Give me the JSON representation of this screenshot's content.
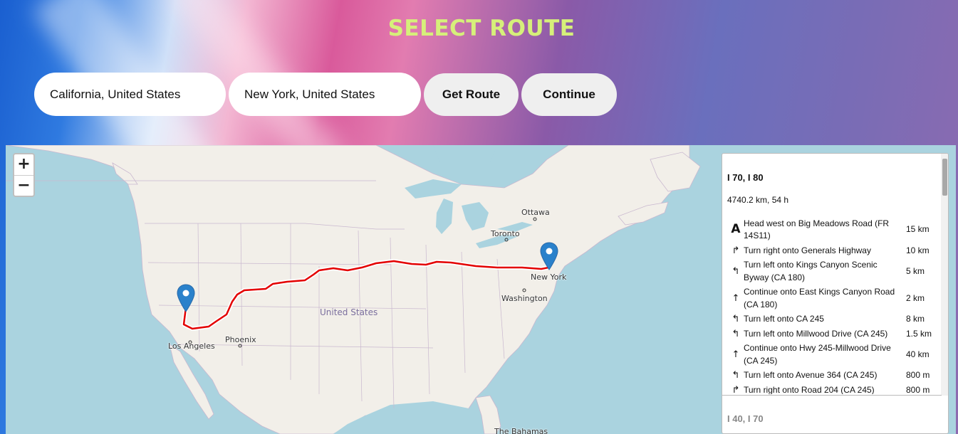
{
  "page": {
    "title": "SELECT ROUTE"
  },
  "form": {
    "from_value": "California, United States",
    "to_value": "New York, United States",
    "get_route_label": "Get Route",
    "continue_label": "Continue"
  },
  "map": {
    "zoom_in": "+",
    "zoom_out": "−",
    "country_label": "United States",
    "cities": [
      "Ottawa",
      "Toronto",
      "New York",
      "Washington",
      "Los Angeles",
      "Phoenix",
      "The Bahamas"
    ],
    "origin_marker": "map-pin-icon",
    "destination_marker": "map-pin-icon",
    "route_color": "#e30000"
  },
  "directions": {
    "route_name": "I 70, I 80",
    "summary": "4740.2 km, 54 h",
    "steps": [
      {
        "icon": "depart-icon",
        "text": "Head west on Big Meadows Road (FR 14S11)",
        "distance": "15 km"
      },
      {
        "icon": "turn-right-icon",
        "text": "Turn right onto Generals Highway",
        "distance": "10 km"
      },
      {
        "icon": "turn-left-icon",
        "text": "Turn left onto Kings Canyon Scenic Byway (CA 180)",
        "distance": "5 km"
      },
      {
        "icon": "straight-icon",
        "text": "Continue onto East Kings Canyon Road (CA 180)",
        "distance": "2 km"
      },
      {
        "icon": "turn-left-icon",
        "text": "Turn left onto CA 245",
        "distance": "8 km"
      },
      {
        "icon": "turn-left-icon",
        "text": "Turn left onto Millwood Drive (CA 245)",
        "distance": "1.5 km"
      },
      {
        "icon": "straight-icon",
        "text": "Continue onto Hwy 245-Millwood Drive (CA 245)",
        "distance": "40 km"
      },
      {
        "icon": "turn-left-icon",
        "text": "Turn left onto Avenue 364 (CA 245)",
        "distance": "800 m"
      },
      {
        "icon": "turn-right-icon",
        "text": "Turn right onto Road 204 (CA 245)",
        "distance": "800 m"
      }
    ],
    "alternative_route_name": "I 40, I 70"
  }
}
